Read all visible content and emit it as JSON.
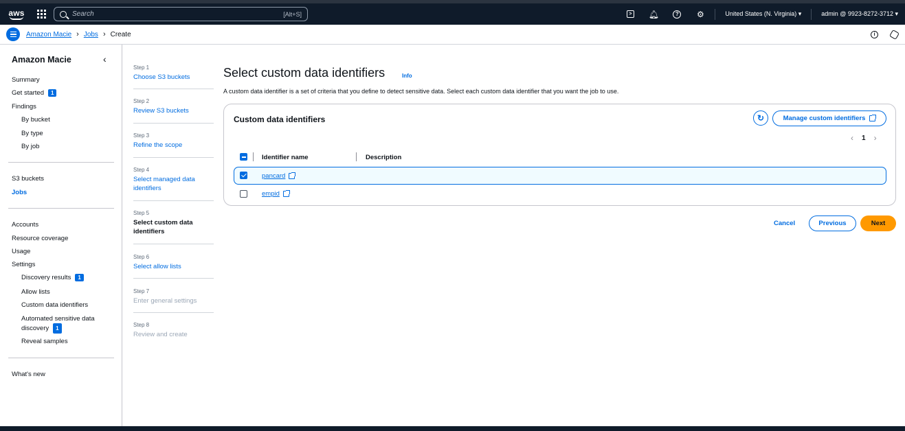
{
  "topbar": {
    "logo_text": "aws",
    "search_placeholder": "Search",
    "search_shortcut": "[Alt+S]",
    "region": "United States (N. Virginia) ▾",
    "account": "admin @ 9923-8272-3712 ▾",
    "icons": [
      "cloudshell-icon",
      "bell-icon",
      "help-icon",
      "settings-icon"
    ]
  },
  "breadcrumb": {
    "items": [
      "Amazon Macie",
      "Jobs",
      "Create"
    ]
  },
  "sidenav": {
    "title": "Amazon Macie",
    "group1": [
      "Summary",
      "Get started",
      "Findings",
      "By bucket",
      "By type",
      "By job"
    ],
    "get_started_badge": "1",
    "group2": [
      "S3 buckets",
      "Jobs"
    ],
    "group3": [
      "Accounts",
      "Resource coverage",
      "Usage",
      "Settings",
      "Discovery results",
      "Allow lists",
      "Custom data identifiers",
      "Automated sensitive data discovery",
      "Reveal samples"
    ],
    "discovery_badge": "1",
    "automated_badge": "1",
    "whats_new": "What's new"
  },
  "steps": [
    {
      "num": "Step 1",
      "label": "Choose S3 buckets",
      "state": "link"
    },
    {
      "num": "Step 2",
      "label": "Review S3 buckets",
      "state": "link"
    },
    {
      "num": "Step 3",
      "label": "Refine the scope",
      "state": "link"
    },
    {
      "num": "Step 4",
      "label": "Select managed data identifiers",
      "state": "link"
    },
    {
      "num": "Step 5",
      "label": "Select custom data identifiers",
      "state": "current"
    },
    {
      "num": "Step 6",
      "label": "Select allow lists",
      "state": "link"
    },
    {
      "num": "Step 7",
      "label": "Enter general settings",
      "state": "disabled"
    },
    {
      "num": "Step 8",
      "label": "Review and create",
      "state": "disabled"
    }
  ],
  "main": {
    "title": "Select custom data identifiers",
    "info": "Info",
    "description": "A custom data identifier is a set of criteria that you define to detect sensitive data. Select each custom data identifier that you want the job to use."
  },
  "panel": {
    "title": "Custom data identifiers",
    "manage_button": "Manage custom identifiers",
    "page": "1",
    "columns": [
      "Identifier name",
      "Description"
    ],
    "rows": [
      {
        "name": "pancard",
        "description": "",
        "selected": true
      },
      {
        "name": "empid",
        "description": "",
        "selected": false
      }
    ]
  },
  "actions": {
    "cancel": "Cancel",
    "previous": "Previous",
    "next": "Next"
  },
  "colors": {
    "accent": "#006ce0",
    "primary_button": "#ff9900",
    "topbar": "#0f1b2a"
  }
}
